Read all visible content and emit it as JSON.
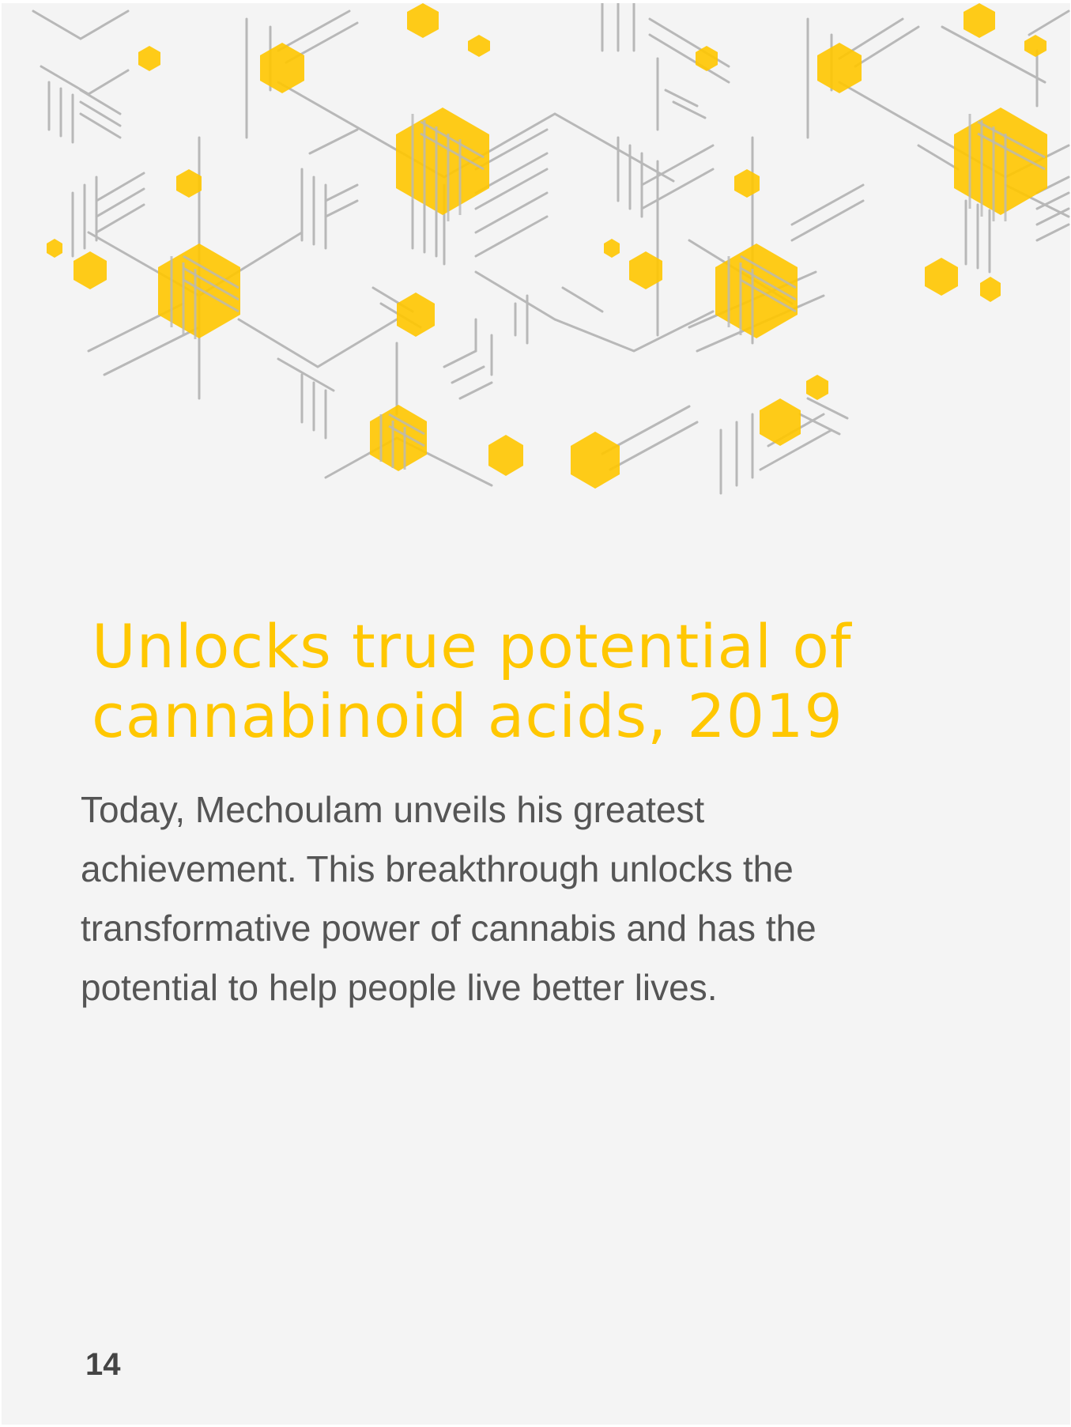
{
  "page": {
    "title": "Unlocks true potential of cannabinoid acids, 2019",
    "body": "Today, Mechoulam unveils his greatest achievement. This breakthrough unlocks the transformative power of cannabis and has the potential to help people live better lives.",
    "page_number": "14"
  },
  "artwork": {
    "icon": "molecular-hexagon-network-illustration",
    "accent_color": "#ffc700",
    "line_color": "#b8b8b8"
  }
}
